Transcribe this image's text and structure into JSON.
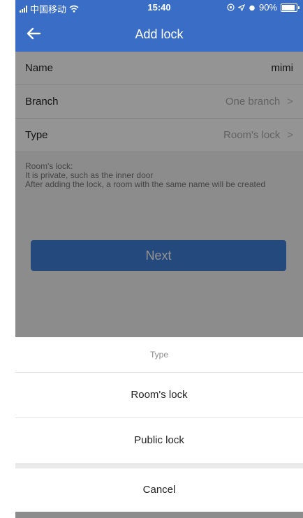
{
  "status_bar": {
    "carrier": "中国移动",
    "time": "15:40",
    "battery": "90%"
  },
  "nav": {
    "title": "Add lock",
    "back_icon": "arrow-left-icon"
  },
  "form": {
    "name": {
      "label": "Name",
      "value": "mimi"
    },
    "branch": {
      "label": "Branch",
      "value": "One branch"
    },
    "type": {
      "label": "Type",
      "value": "Room's lock"
    },
    "chevron": ">"
  },
  "hint": "Room's lock:\n It is private, such as the inner door\n After adding the lock, a room with the same name will be created",
  "next_label": "Next",
  "action_sheet": {
    "title": "Type",
    "options": [
      "Room's lock",
      "Public lock"
    ],
    "cancel": "Cancel"
  },
  "colors": {
    "accent": "#3a6ec6",
    "button": "#3f7fd8"
  }
}
